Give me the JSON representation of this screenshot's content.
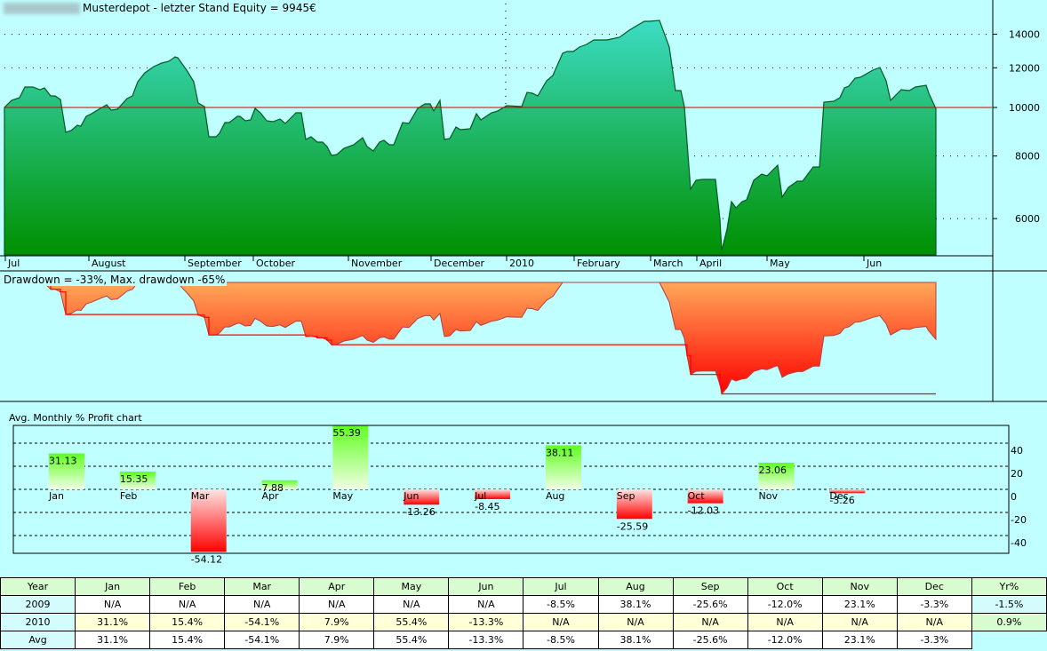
{
  "header": {
    "title": "Musterdepot - letzter Stand Equity = 9945€"
  },
  "drawdown": {
    "label": "Drawdown = -33%, Max. drawdown -65%"
  },
  "profit_chart": {
    "title": "Avg. Monthly % Profit chart"
  },
  "colors": {
    "background": "#c0ffff",
    "equity_top": "#3cdcc4",
    "equity_bottom": "#009000",
    "dd_top": "#ffa858",
    "dd_bottom": "#ff0000",
    "ref_line": "#cc0000"
  },
  "chart_data": [
    {
      "type": "area",
      "title": "Musterdepot - letzter Stand Equity = 9945€",
      "yscale": "log",
      "ylim": [
        4600,
        16000
      ],
      "yticks": [
        6000,
        8000,
        10000,
        12000,
        14000
      ],
      "reference_line": 10000,
      "xlim": [
        0,
        277.75
      ],
      "xlabel_unit": "trading day index",
      "month_ticks": [
        {
          "label": "Jul",
          "x": 0
        },
        {
          "label": "August",
          "x": 23.5
        },
        {
          "label": "September",
          "x": 50.5
        },
        {
          "label": "October",
          "x": 69.75
        },
        {
          "label": "November",
          "x": 96.5
        },
        {
          "label": "December",
          "x": 119.75
        },
        {
          "label": "2010",
          "x": 141
        },
        {
          "label": "February",
          "x": 160
        },
        {
          "label": "March",
          "x": 181.5
        },
        {
          "label": "April",
          "x": 194.5
        },
        {
          "label": "May",
          "x": 214.25
        },
        {
          "label": "Jun",
          "x": 241.5
        }
      ],
      "year_divider_x": 141,
      "series": [
        {
          "name": "Equity",
          "points": [
            [
              0,
              10000
            ],
            [
              2,
              10332
            ],
            [
              4.25,
              10459
            ],
            [
              5.75,
              10984
            ],
            [
              8,
              10984
            ],
            [
              10,
              10851
            ],
            [
              11.25,
              10940
            ],
            [
              13,
              10545
            ],
            [
              14.25,
              10545
            ],
            [
              15.75,
              10374
            ],
            [
              17.25,
              8920
            ],
            [
              18.75,
              8993
            ],
            [
              20.5,
              9216
            ],
            [
              21.5,
              9179
            ],
            [
              23,
              9600
            ],
            [
              24.5,
              9718
            ],
            [
              27,
              9959
            ],
            [
              28.75,
              10123
            ],
            [
              30,
              9878
            ],
            [
              31.75,
              9919
            ],
            [
              34.5,
              10417
            ],
            [
              36,
              10545
            ],
            [
              37.5,
              11257
            ],
            [
              39.5,
              11726
            ],
            [
              42,
              12066
            ],
            [
              44.25,
              12264
            ],
            [
              46.25,
              12364
            ],
            [
              48,
              12620
            ],
            [
              48.75,
              12568
            ],
            [
              51.25,
              11870
            ],
            [
              53.25,
              11257
            ],
            [
              54.5,
              10206
            ],
            [
              56.25,
              10041
            ],
            [
              57.5,
              8740
            ],
            [
              59.5,
              8740
            ],
            [
              60.5,
              8884
            ],
            [
              62,
              9330
            ],
            [
              63.25,
              9330
            ],
            [
              65.5,
              9600
            ],
            [
              66.25,
              9600
            ],
            [
              67.75,
              9406
            ],
            [
              69.25,
              9445
            ],
            [
              70.5,
              9959
            ],
            [
              72,
              9758
            ],
            [
              73.75,
              9406
            ],
            [
              75.5,
              9368
            ],
            [
              77.5,
              9483
            ],
            [
              79,
              9292
            ],
            [
              80.75,
              9561
            ],
            [
              82,
              9758
            ],
            [
              83.5,
              9758
            ],
            [
              84.75,
              8633
            ],
            [
              86.25,
              8740
            ],
            [
              88,
              8528
            ],
            [
              89.5,
              8528
            ],
            [
              90.75,
              8356
            ],
            [
              92,
              8022
            ],
            [
              93.5,
              8055
            ],
            [
              95.5,
              8288
            ],
            [
              98.25,
              8425
            ],
            [
              100.75,
              8704
            ],
            [
              102,
              8356
            ],
            [
              103.75,
              8187
            ],
            [
              105.5,
              8528
            ],
            [
              106.75,
              8598
            ],
            [
              108.25,
              8425
            ],
            [
              109.5,
              8425
            ],
            [
              112,
              9330
            ],
            [
              113.75,
              9292
            ],
            [
              116.25,
              9959
            ],
            [
              118.25,
              10165
            ],
            [
              119.75,
              10165
            ],
            [
              120.75,
              9838
            ],
            [
              122.5,
              10332
            ],
            [
              123.75,
              8633
            ],
            [
              125.25,
              8669
            ],
            [
              127,
              9141
            ],
            [
              128.25,
              9030
            ],
            [
              131,
              9067
            ],
            [
              132.75,
              9718
            ],
            [
              134,
              9445
            ],
            [
              137,
              9758
            ],
            [
              138.75,
              9838
            ],
            [
              141.25,
              10082
            ],
            [
              145.5,
              10041
            ],
            [
              147,
              10719
            ],
            [
              148.5,
              10675
            ],
            [
              150,
              10545
            ],
            [
              152.5,
              11303
            ],
            [
              154.25,
              11583
            ],
            [
              157,
              12827
            ],
            [
              158.25,
              12932
            ],
            [
              160,
              12932
            ],
            [
              161.75,
              13200
            ],
            [
              163.75,
              13362
            ],
            [
              165.75,
              13637
            ],
            [
              169.5,
              13637
            ],
            [
              173,
              13805
            ],
            [
              175.75,
              14264
            ],
            [
              178.25,
              14617
            ],
            [
              180,
              14857
            ],
            [
              181.25,
              14857
            ],
            [
              184.25,
              14918
            ],
            [
              187,
              13200
            ],
            [
              188.75,
              10807
            ],
            [
              190.25,
              10807
            ],
            [
              191.25,
              10041
            ],
            [
              192,
              8528
            ],
            [
              193,
              6870
            ],
            [
              194.5,
              7156
            ],
            [
              196.25,
              7185
            ],
            [
              200,
              7185
            ],
            [
              201.25,
              5979
            ],
            [
              201.75,
              5184
            ],
            [
              203.25,
              5716
            ],
            [
              204.5,
              6488
            ],
            [
              205.75,
              6306
            ],
            [
              207.5,
              6488
            ],
            [
              208.75,
              6541
            ],
            [
              210.75,
              7156
            ],
            [
              213,
              7363
            ],
            [
              214.5,
              7303
            ],
            [
              217.5,
              7670
            ],
            [
              218.75,
              6622
            ],
            [
              220.5,
              6926
            ],
            [
              223,
              7127
            ],
            [
              224.5,
              7127
            ],
            [
              227.5,
              7607
            ],
            [
              229.25,
              7607
            ],
            [
              230.5,
              10248
            ],
            [
              233.25,
              10290
            ],
            [
              235,
              10459
            ],
            [
              236.25,
              10940
            ],
            [
              237.5,
              11030
            ],
            [
              239.25,
              11442
            ],
            [
              240.75,
              11489
            ],
            [
              244.25,
              11870
            ],
            [
              246.25,
              12016
            ],
            [
              248,
              11303
            ],
            [
              249.25,
              10332
            ],
            [
              252.25,
              10851
            ],
            [
              254.5,
              10807
            ],
            [
              256.25,
              10984
            ],
            [
              259.25,
              11074
            ],
            [
              260,
              10675
            ],
            [
              262,
              9945
            ]
          ]
        }
      ]
    },
    {
      "type": "area",
      "title": "Drawdown = -33%, Max. drawdown -65%",
      "derived_from": "Equity",
      "ylim": [
        -0.65,
        0
      ],
      "current_drawdown_pct": -33,
      "max_drawdown_pct": -65
    },
    {
      "type": "bar",
      "title": "Avg. Monthly % Profit chart",
      "categories": [
        "Jan",
        "Feb",
        "Mar",
        "Apr",
        "May",
        "Jun",
        "Jul",
        "Aug",
        "Sep",
        "Oct",
        "Nov",
        "Dec"
      ],
      "values": [
        31.13,
        15.35,
        -54.12,
        7.88,
        55.39,
        -13.26,
        -8.45,
        38.11,
        -25.59,
        -12.03,
        23.06,
        -3.26
      ],
      "value_labels": [
        "31.13",
        "15.35",
        "-54.12",
        "7.88",
        "55.39",
        "-13.26",
        "-8.45",
        "38.11",
        "-25.59",
        "-12.03",
        "23.06",
        "-3.26"
      ],
      "ylim": [
        -55.4,
        55.4
      ],
      "yticks": [
        40,
        20,
        0,
        -20,
        -40
      ],
      "grid": true
    }
  ],
  "table": {
    "headers": [
      "Year",
      "Jan",
      "Feb",
      "Mar",
      "Apr",
      "May",
      "Jun",
      "Jul",
      "Aug",
      "Sep",
      "Oct",
      "Nov",
      "Dec",
      "Yr%"
    ],
    "rows": [
      {
        "year": "2009",
        "cells": [
          "N/A",
          "N/A",
          "N/A",
          "N/A",
          "N/A",
          "N/A",
          "-8.5%",
          "38.1%",
          "-25.6%",
          "-12.0%",
          "23.1%",
          "-3.3%"
        ],
        "total": "-1.5%"
      },
      {
        "year": "2010",
        "cells": [
          "31.1%",
          "15.4%",
          "-54.1%",
          "7.9%",
          "55.4%",
          "-13.3%",
          "N/A",
          "N/A",
          "N/A",
          "N/A",
          "N/A",
          "N/A"
        ],
        "total": "0.9%"
      },
      {
        "year": "Avg",
        "cells": [
          "31.1%",
          "15.4%",
          "-54.1%",
          "7.9%",
          "55.4%",
          "-13.3%",
          "-8.5%",
          "38.1%",
          "-25.6%",
          "-12.0%",
          "23.1%",
          "-3.3%"
        ],
        "total": ""
      }
    ]
  }
}
